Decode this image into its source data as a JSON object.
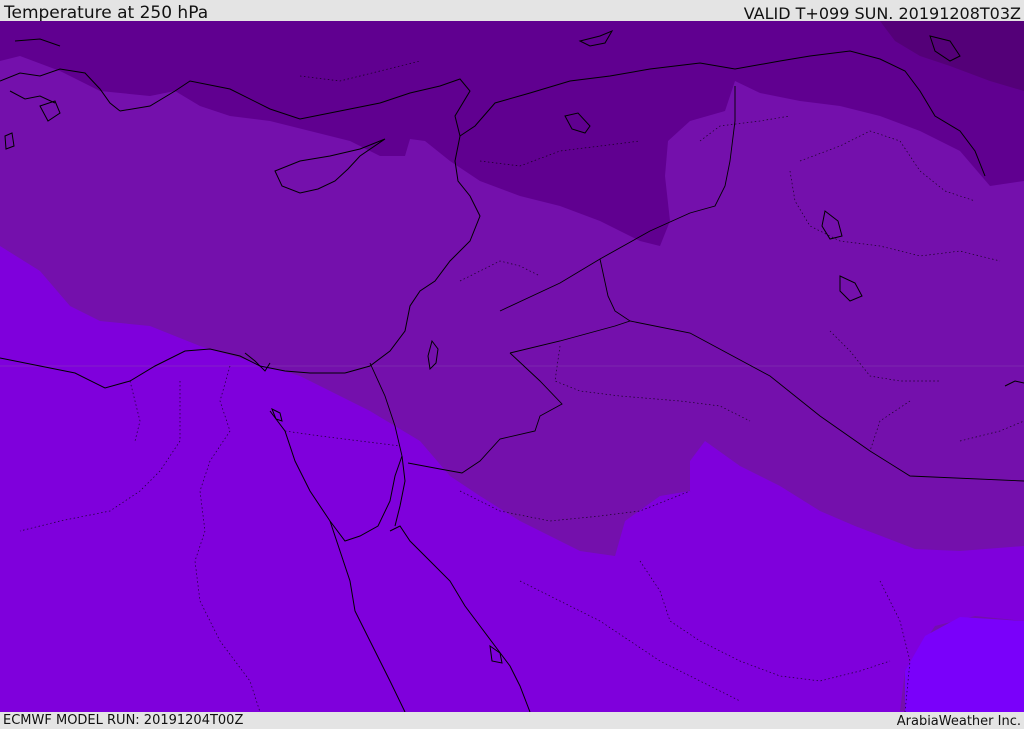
{
  "header": {
    "title": "Temperature at 250 hPa",
    "valid": "VALID T+099 SUN. 20191208T03Z"
  },
  "footer": {
    "model_run": "ECMWF MODEL RUN: 20191204T00Z",
    "credit": "ArabiaWeather Inc."
  },
  "map": {
    "colors": {
      "band_darkest": "#540078",
      "band_dark": "#600090",
      "band_mid": "#7410ac",
      "band_light": "#7f00dc",
      "band_lightest": "#7a00fa",
      "coastline": "#000000"
    }
  }
}
